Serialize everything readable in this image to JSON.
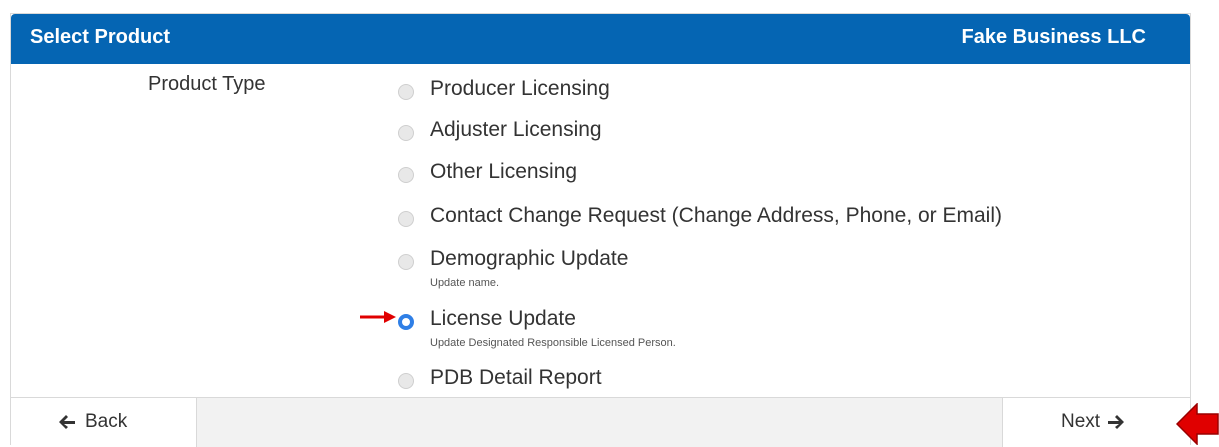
{
  "header": {
    "title": "Select Product",
    "company": "Fake Business LLC",
    "color": "#0565b3"
  },
  "form": {
    "field_label": "Product Type",
    "options": [
      {
        "label": "Producer Licensing",
        "description": "",
        "checked": false
      },
      {
        "label": "Adjuster Licensing",
        "description": "",
        "checked": false
      },
      {
        "label": "Other Licensing",
        "description": "",
        "checked": false
      },
      {
        "label": "Contact Change Request (Change Address, Phone, or Email)",
        "description": "",
        "checked": false
      },
      {
        "label": "Demographic Update",
        "description": "Update name.",
        "checked": false
      },
      {
        "label": "License Update",
        "description": "Update Designated Responsible Licensed Person.",
        "checked": true
      },
      {
        "label": "PDB Detail Report",
        "description": "",
        "checked": false
      }
    ]
  },
  "footer": {
    "back_label": "Back",
    "next_label": "Next",
    "back_icon": "arrow-left-icon",
    "next_icon": "arrow-right-icon"
  },
  "annotations": {
    "pointer_color": "#e00000"
  }
}
